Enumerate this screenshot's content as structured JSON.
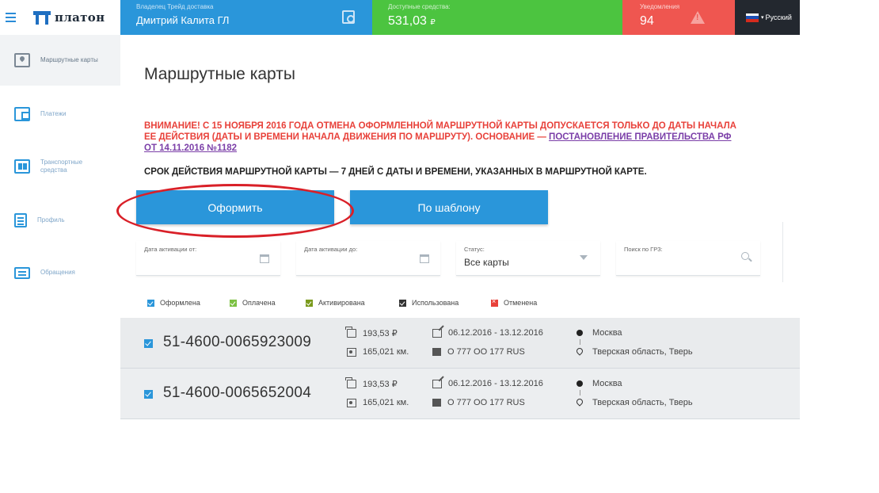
{
  "app": {
    "logo_text": "платон"
  },
  "topbar": {
    "owner_label": "Владелец Трейд доставка",
    "owner_name": "Дмитрий Калита ГЛ",
    "balance_label": "Доступные средства:",
    "balance_value": "531,03",
    "currency": "₽",
    "notify_label": "Уведомления",
    "notify_count": "94",
    "language": "Русский",
    "colors": {
      "blue": "#2a96da",
      "green": "#4cc440",
      "red": "#ef5650",
      "dark": "#23282f"
    }
  },
  "sidebar": {
    "items": [
      {
        "label": "Маршрутные карты",
        "icon": "map-icon",
        "active": true
      },
      {
        "label": "Платежи",
        "icon": "wallet-icon",
        "active": false
      },
      {
        "label": "Транспортные средства",
        "icon": "truck-icon",
        "active": false
      },
      {
        "label": "Профиль",
        "icon": "profile-icon",
        "active": false
      },
      {
        "label": "Обращения",
        "icon": "chat-icon",
        "active": false
      }
    ]
  },
  "main": {
    "title": "Маршрутные карты",
    "warning_text": "ВНИМАНИЕ! С 15 НОЯБРЯ 2016 ГОДА ОТМЕНА ОФОРМЛЕННОЙ МАРШРУТНОЙ КАРТЫ ДОПУСКАЕТСЯ ТОЛЬКО ДО ДАТЫ НАЧАЛА ЕЕ ДЕЙСТВИЯ (ДАТЫ И ВРЕМЕНИ НАЧАЛА ДВИЖЕНИЯ ПО МАРШРУТУ). ОСНОВАНИЕ —",
    "warning_link": "ПОСТАНОВЛЕНИЕ ПРАВИТЕЛЬСТВА РФ ОТ 14.11.2016 №1182",
    "validity_text": "СРОК ДЕЙСТВИЯ МАРШРУТНОЙ КАРТЫ — 7 ДНЕЙ С ДАТЫ И ВРЕМЕНИ, УКАЗАННЫХ В МАРШРУТНОЙ КАРТЕ.",
    "btn_issue": "Оформить",
    "btn_template": "По шаблону",
    "filters": {
      "date_from_label": "Дата активации от:",
      "date_to_label": "Дата активации до:",
      "status_label": "Статус:",
      "status_value": "Все карты",
      "search_label": "Поиск по ГРЗ:"
    },
    "legend": [
      {
        "label": "Оформлена",
        "color": "#2a96da"
      },
      {
        "label": "Оплачена",
        "color": "#7cc142"
      },
      {
        "label": "Активирована",
        "color": "#7a9a1c"
      },
      {
        "label": "Использована",
        "color": "#333333"
      },
      {
        "label": "Отменена",
        "color": "#e8413a"
      }
    ],
    "rows": [
      {
        "number": "51-4600-0065923009",
        "cost": "193,53 ₽",
        "distance": "165,021 км.",
        "dates": "06.12.2016 - 13.12.2016",
        "vehicle": "О 777 ОО 177 RUS",
        "from": "Москва",
        "to": "Тверская область, Тверь"
      },
      {
        "number": "51-4600-0065652004",
        "cost": "193,53 ₽",
        "distance": "165,021 км.",
        "dates": "06.12.2016 - 13.12.2016",
        "vehicle": "О 777 ОО 177 RUS",
        "from": "Москва",
        "to": "Тверская область, Тверь"
      }
    ]
  }
}
